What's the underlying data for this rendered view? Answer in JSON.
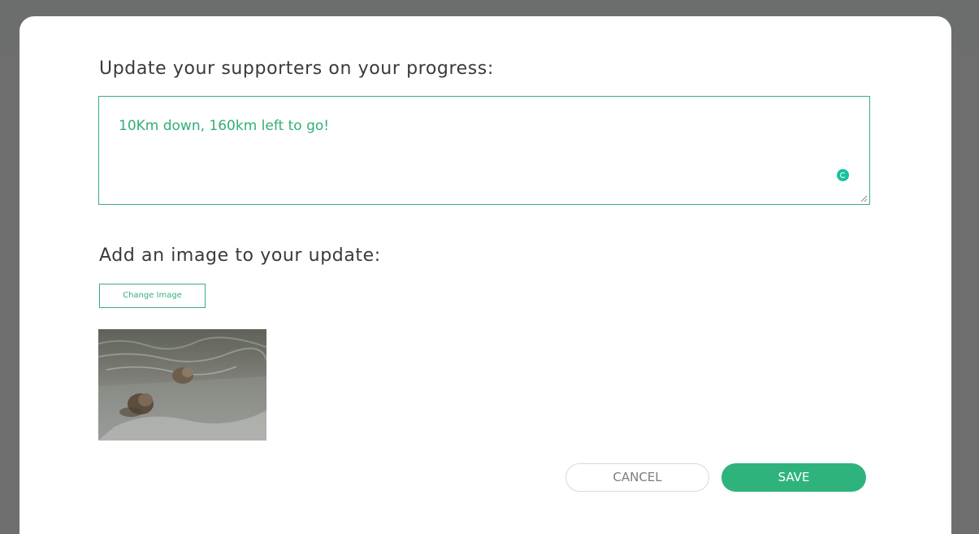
{
  "modal": {
    "close_icon": "close-icon",
    "close_glyph": "✕",
    "progress_heading": "Update your supporters on your progress:",
    "update_text": "10Km down, 160km left to go!",
    "image_heading": "Add an image to your update:",
    "change_image_label": "Change Image",
    "cancel_label": "CANCEL",
    "save_label": "SAVE"
  },
  "colors": {
    "accent": "#2fb37c",
    "backdrop": "#6e6e6e",
    "heading_text": "#3a3a3a",
    "cancel_text": "#7d7d7d"
  },
  "icons": {
    "grammarly": "grammarly-icon",
    "resize": "resize-handle-icon",
    "close": "close-icon"
  },
  "image": {
    "semantic": "update-image-thumbnail"
  }
}
